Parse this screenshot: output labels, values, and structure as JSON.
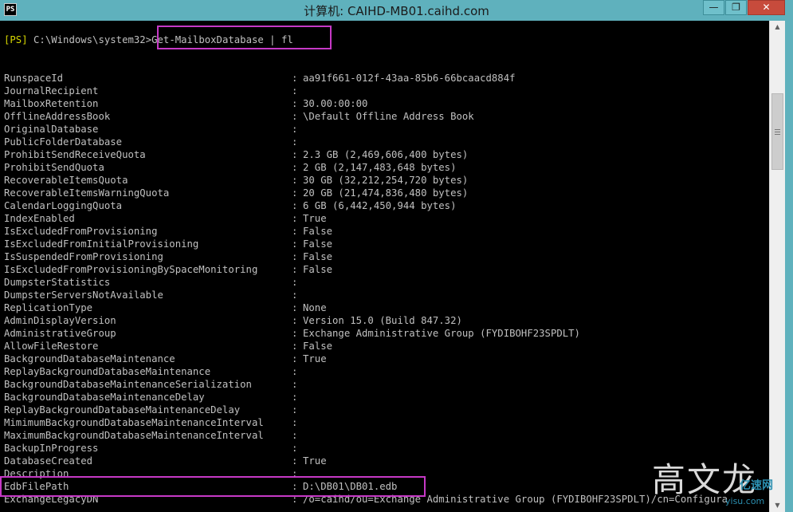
{
  "window": {
    "title": "计算机: CAIHD-MB01.caihd.com",
    "icon_label": "PS",
    "buttons": {
      "minimize": "—",
      "maximize": "❐",
      "close": "✕"
    }
  },
  "console": {
    "prompt_tag": "[PS]",
    "prompt_path": " C:\\Windows\\system32>",
    "command": "Get-MailboxDatabase | fl",
    "separator": ":",
    "rows": [
      {
        "key": "RunspaceId",
        "value": "aa91f661-012f-43aa-85b6-66bcaacd884f"
      },
      {
        "key": "JournalRecipient",
        "value": ""
      },
      {
        "key": "MailboxRetention",
        "value": "30.00:00:00"
      },
      {
        "key": "OfflineAddressBook",
        "value": "\\Default Offline Address Book"
      },
      {
        "key": "OriginalDatabase",
        "value": ""
      },
      {
        "key": "PublicFolderDatabase",
        "value": ""
      },
      {
        "key": "ProhibitSendReceiveQuota",
        "value": "2.3 GB (2,469,606,400 bytes)"
      },
      {
        "key": "ProhibitSendQuota",
        "value": "2 GB (2,147,483,648 bytes)"
      },
      {
        "key": "RecoverableItemsQuota",
        "value": "30 GB (32,212,254,720 bytes)"
      },
      {
        "key": "RecoverableItemsWarningQuota",
        "value": "20 GB (21,474,836,480 bytes)"
      },
      {
        "key": "CalendarLoggingQuota",
        "value": "6 GB (6,442,450,944 bytes)"
      },
      {
        "key": "IndexEnabled",
        "value": "True"
      },
      {
        "key": "IsExcludedFromProvisioning",
        "value": "False"
      },
      {
        "key": "IsExcludedFromInitialProvisioning",
        "value": "False"
      },
      {
        "key": "IsSuspendedFromProvisioning",
        "value": "False"
      },
      {
        "key": "IsExcludedFromProvisioningBySpaceMonitoring",
        "value": "False"
      },
      {
        "key": "DumpsterStatistics",
        "value": ""
      },
      {
        "key": "DumpsterServersNotAvailable",
        "value": ""
      },
      {
        "key": "ReplicationType",
        "value": "None"
      },
      {
        "key": "AdminDisplayVersion",
        "value": "Version 15.0 (Build 847.32)"
      },
      {
        "key": "AdministrativeGroup",
        "value": "Exchange Administrative Group (FYDIBOHF23SPDLT)"
      },
      {
        "key": "AllowFileRestore",
        "value": "False"
      },
      {
        "key": "BackgroundDatabaseMaintenance",
        "value": "True"
      },
      {
        "key": "ReplayBackgroundDatabaseMaintenance",
        "value": ""
      },
      {
        "key": "BackgroundDatabaseMaintenanceSerialization",
        "value": ""
      },
      {
        "key": "BackgroundDatabaseMaintenanceDelay",
        "value": ""
      },
      {
        "key": "ReplayBackgroundDatabaseMaintenanceDelay",
        "value": ""
      },
      {
        "key": "MimimumBackgroundDatabaseMaintenanceInterval",
        "value": ""
      },
      {
        "key": "MaximumBackgroundDatabaseMaintenanceInterval",
        "value": ""
      },
      {
        "key": "BackupInProgress",
        "value": ""
      },
      {
        "key": "DatabaseCreated",
        "value": "True"
      },
      {
        "key": "Description",
        "value": ""
      },
      {
        "key": "EdbFilePath",
        "value": "D:\\DB01\\DB01.edb"
      },
      {
        "key": "ExchangeLegacyDN",
        "value": "/o=caihd/ou=Exchange Administrative Group (FYDIBOHF23SPDLT)/cn=Configura"
      }
    ]
  },
  "watermark": {
    "main": "高文龙",
    "sub": "亿速网",
    "url": "yisu.com"
  },
  "colors": {
    "console_bg": "#000000",
    "console_fg": "#c0c0c0",
    "prompt_tag": "#d7d700",
    "highlight_box": "#c639c6",
    "titlebar": "#5fb1bd"
  }
}
